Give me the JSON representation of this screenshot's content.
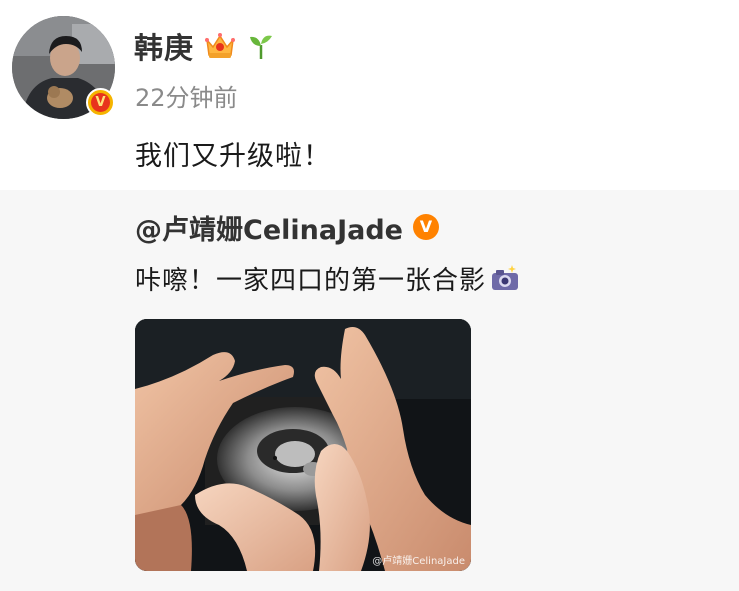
{
  "post": {
    "author": "韩庚",
    "time": "22分钟前",
    "text": "我们又升级啦！",
    "icons": [
      "verified-v-icon",
      "crown-icon",
      "sprout-icon"
    ]
  },
  "repost": {
    "author": "@卢靖姗CelinaJade",
    "text": "咔嚓！一家四口的第一张合影",
    "icons": [
      "orange-verified-icon",
      "camera-icon"
    ],
    "image": {
      "watermark": "@卢靖姗CelinaJade"
    }
  },
  "colors": {
    "verified_gold": "#f5b400",
    "verified_red": "#e8331d",
    "repost_verified": "#ff8200",
    "repost_bg": "#f7f7f7",
    "time_gray": "#8a8a8a"
  }
}
